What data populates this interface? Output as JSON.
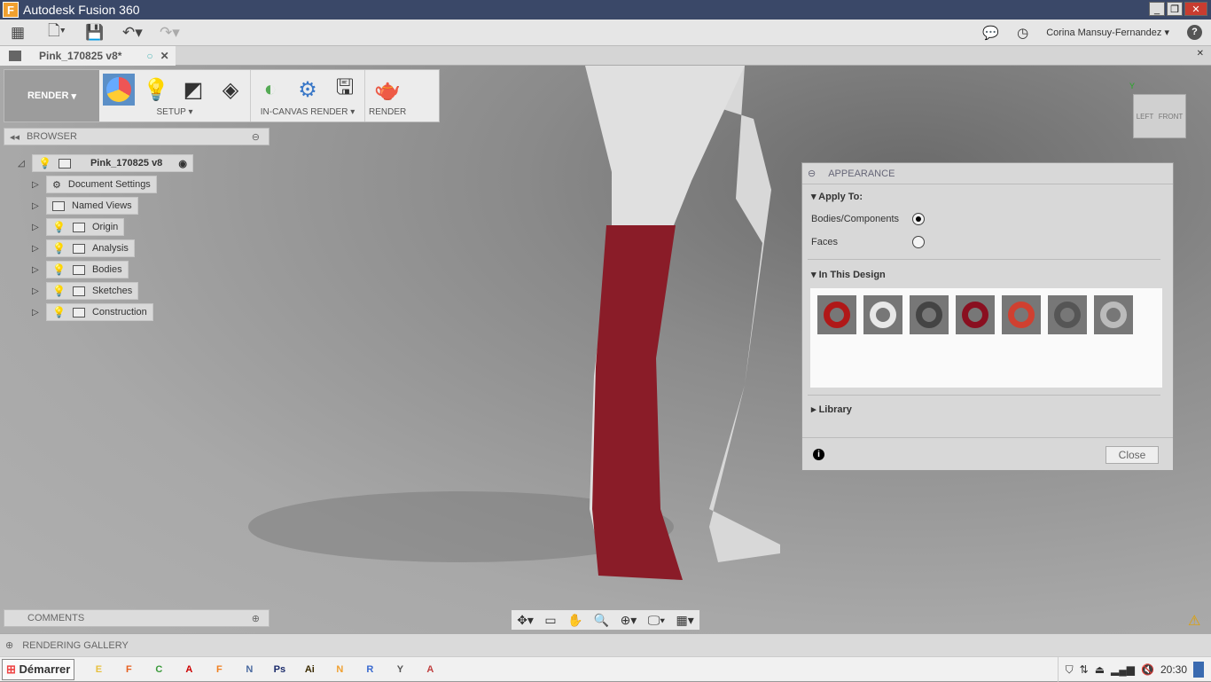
{
  "window": {
    "title": "Autodesk Fusion 360",
    "logo": "F"
  },
  "qat": {
    "user": "Corina Mansuy-Fernandez",
    "help": "?"
  },
  "doc_tab": {
    "label": "Pink_170825 v8*"
  },
  "toolbar": {
    "workspace": "RENDER",
    "groups": [
      {
        "label": "SETUP"
      },
      {
        "label": "IN-CANVAS RENDER"
      },
      {
        "label": "RENDER"
      }
    ]
  },
  "browser": {
    "title": "BROWSER",
    "root": "Pink_170825 v8",
    "items": [
      "Document Settings",
      "Named Views",
      "Origin",
      "Analysis",
      "Bodies",
      "Sketches",
      "Construction"
    ]
  },
  "comments": {
    "title": "COMMENTS"
  },
  "gallery": {
    "title": "RENDERING GALLERY"
  },
  "viewcube": {
    "left": "LEFT",
    "front": "FRONT",
    "axis": "Y"
  },
  "appearance": {
    "title": "APPEARANCE",
    "apply_to": "Apply To:",
    "opt1": "Bodies/Components",
    "opt2": "Faces",
    "selected": "Bodies/Components",
    "in_design": "In This Design",
    "library": "Library",
    "close": "Close",
    "swatch_colors": [
      "#b01818",
      "#e8e8e8",
      "#444444",
      "#8a0f20",
      "#d04030",
      "#555555",
      "#bbbbbb"
    ]
  },
  "taskbar": {
    "start": "Démarrer",
    "apps": [
      "Explorer",
      "Firefox",
      "Chrome",
      "Acrobat",
      "Fusion 360",
      "Network",
      "Ps",
      "Ai",
      "N",
      "R",
      "Y",
      "App"
    ],
    "clock": "20:30"
  }
}
